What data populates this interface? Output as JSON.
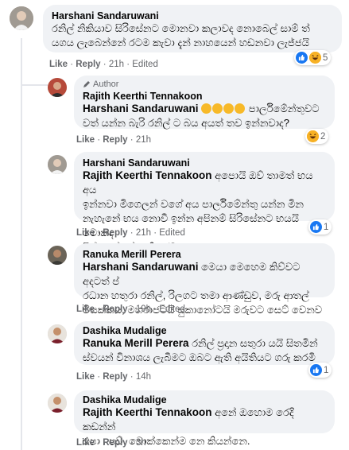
{
  "actions": {
    "like": "Like",
    "reply": "Reply",
    "edited": "Edited",
    "sep": " · "
  },
  "comments": [
    {
      "author": "Harshani Sandaruwani",
      "lines": [
        "රනිල් නිකියාව සිරිසේනට මොනවා කලාවද නොබෙල් සාම් ත්",
        "යගය ලැබෙන්නේ රටම කැවා දැන් නාහයෙන් හඩනවා ලැජ්ජයි"
      ],
      "time": "21h",
      "edited": true,
      "reaction_count": "5",
      "reaction_icons": [
        "like-reaction-icon",
        "haha-reaction-icon"
      ]
    },
    {
      "author_badge": "Author",
      "author": "Rajith Keerthi Tennakoon",
      "tag": "Harshani Sandaruwani",
      "emoji_count": 4,
      "lines_after_tag": "පාර්ලිමේන්තුවට",
      "lines": [
        "වත් යන්න බැරි රනිල් ට බය අයත් තව ඉන්නවාද?"
      ],
      "time": "21h",
      "reaction_count": "2",
      "reaction_icons": [
        "haha-reaction-icon"
      ]
    },
    {
      "author": "Harshani Sandaruwani",
      "tag": "Rajith Keerthi Tennakoon",
      "first_line_text": "අපොයි ඔව් තාමත් භය අය",
      "lines": [
        "ඉන්නවා මිගෙලන් වගේ අය පාර්ලිමේන්තු යන්න මින",
        "නැහැනේ භය නොවී ඉන්න අපිනම් සිරිසේනට භයයි මොකද",
        "පිස්සෙක්නේ කතිකරම"
      ],
      "time": "21h",
      "edited": true,
      "reaction_count": "1",
      "reaction_icons": [
        "like-reaction-icon"
      ]
    },
    {
      "author": "Ranuka Merill Perera",
      "tag": "Harshani Sandaruwani",
      "first_line_text": "මෙයා මෙහෙම කිව්වට අදටත් ප්",
      "lines": [
        "රධාන හතුරා රනිල්, රිලගට තමා ආණ්ඩුව, මරු ආතල්",
        "විසක්කය, මහරාජටයි සුකානෝටයි මරුවට සෙට් වෙනව"
      ],
      "time": "19h",
      "edited": true
    },
    {
      "author": "Dashika Mudalige",
      "tag": "Ranuka Merill Perera",
      "first_line_text": "රනිල් ප්‍රදාන සතුරා යයි සිතමින්",
      "lines": [
        "ස්වයන් විනාශය ලැබීමට ඔබට ඇති අයිතියට ගරු කරමි"
      ],
      "time": "14h",
      "reaction_count": "1",
      "reaction_icons": [
        "like-reaction-icon"
      ]
    },
    {
      "author": "Dashika Mudalige",
      "tag": "Rajith Keerthi Tennakoon",
      "first_line_text": "අනේ ඔහොම රෙදි කඩන්න්",
      "lines": [
        "එපා . පව්. බොක්කෙන්ම නෙ කියන්නෙ."
      ],
      "time": "3h"
    }
  ],
  "colors": {
    "bubble": "#f0f2f5",
    "meta": "#65676b",
    "like_blue": "#1877f2",
    "haha_yellow": "#f7b125"
  }
}
